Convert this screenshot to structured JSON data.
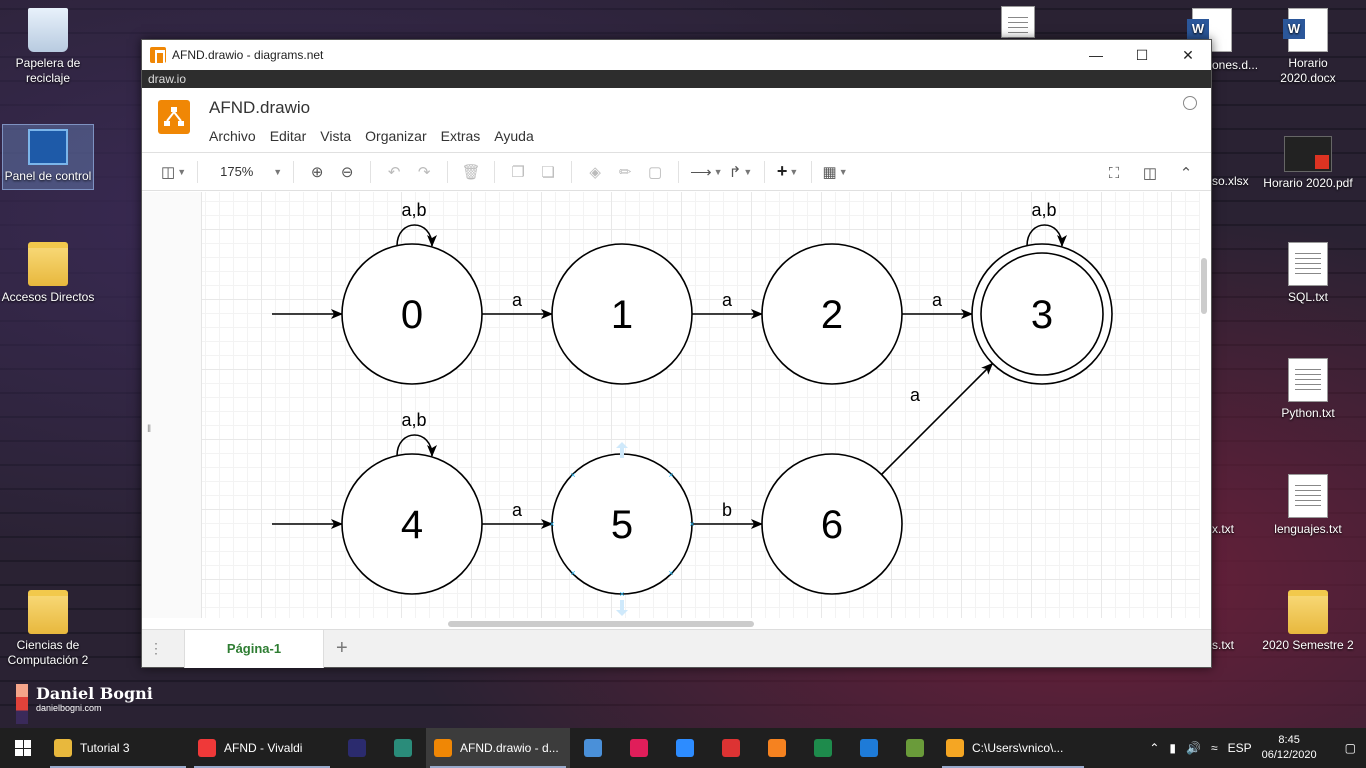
{
  "desktop": {
    "icons_left": [
      {
        "label": "Papelera de reciclaje",
        "icon": "recycle-bin-icon"
      },
      {
        "label": "Panel de control",
        "icon": "control-panel-icon"
      },
      {
        "label": "Accesos Directos",
        "icon": "shortcut-folder-icon"
      },
      {
        "label": "Ciencias de Computación 2",
        "icon": "folder-icon"
      }
    ],
    "icons_right": [
      {
        "label": "Horario 2020.docx",
        "icon": "word-doc-icon"
      },
      {
        "label": "Horario 2020.pdf",
        "icon": "pdf-icon"
      },
      {
        "label": "SQL.txt",
        "icon": "text-file-icon"
      },
      {
        "label": "Python.txt",
        "icon": "text-file-icon"
      },
      {
        "label": "lenguajes.txt",
        "icon": "text-file-icon"
      },
      {
        "label": "2020 Semestre 2",
        "icon": "folder-icon"
      }
    ],
    "partial_labels": [
      "ones.d...",
      "so.xlsx",
      "x.txt",
      "s.txt"
    ],
    "watermark": {
      "name": "Daniel Bogni",
      "url": "danielbogni.com"
    }
  },
  "window": {
    "title": "AFND.drawio - diagrams.net",
    "subbar": "draw.io",
    "doc_title": "AFND.drawio",
    "menus": [
      "Archivo",
      "Editar",
      "Vista",
      "Organizar",
      "Extras",
      "Ayuda"
    ],
    "zoom": "175%",
    "page_tab": "Página-1"
  },
  "diagram": {
    "states": [
      {
        "id": "0",
        "accepting": false
      },
      {
        "id": "1",
        "accepting": false
      },
      {
        "id": "2",
        "accepting": false
      },
      {
        "id": "3",
        "accepting": true
      },
      {
        "id": "4",
        "accepting": false
      },
      {
        "id": "5",
        "accepting": false
      },
      {
        "id": "6",
        "accepting": false
      }
    ],
    "transitions": [
      {
        "from": "0",
        "to": "0",
        "label": "a,b"
      },
      {
        "from": "0",
        "to": "1",
        "label": "a"
      },
      {
        "from": "1",
        "to": "2",
        "label": "a"
      },
      {
        "from": "2",
        "to": "3",
        "label": "a"
      },
      {
        "from": "3",
        "to": "3",
        "label": "a,b"
      },
      {
        "from": "4",
        "to": "4",
        "label": "a,b"
      },
      {
        "from": "4",
        "to": "5",
        "label": "a"
      },
      {
        "from": "5",
        "to": "6",
        "label": "b"
      },
      {
        "from": "6",
        "to": "3",
        "label": "a"
      }
    ],
    "initial_states": [
      "0",
      "4"
    ],
    "selected_state": "5"
  },
  "taskbar": {
    "items": [
      {
        "label": "Tutorial 3",
        "color": "#e8b83d"
      },
      {
        "label": "AFND - Vivaldi",
        "color": "#ef3939"
      },
      {
        "label": "",
        "color": "#2b2b6e"
      },
      {
        "label": "",
        "color": "#2a8c7a"
      },
      {
        "label": "AFND.drawio - d...",
        "color": "#f08705"
      },
      {
        "label": "",
        "color": "#4a90d9"
      },
      {
        "label": "",
        "color": "#e01e5a"
      },
      {
        "label": "",
        "color": "#2d8cff"
      },
      {
        "label": "",
        "color": "#d33"
      },
      {
        "label": "",
        "color": "#f58220"
      },
      {
        "label": "",
        "color": "#1e8b4c"
      },
      {
        "label": "",
        "color": "#1e7bd8"
      },
      {
        "label": "",
        "color": "#6a9b3a"
      },
      {
        "label": "C:\\Users\\vnico\\...",
        "color": "#f5a623"
      }
    ],
    "language": "ESP",
    "time": "8:45",
    "date": "06/12/2020"
  }
}
